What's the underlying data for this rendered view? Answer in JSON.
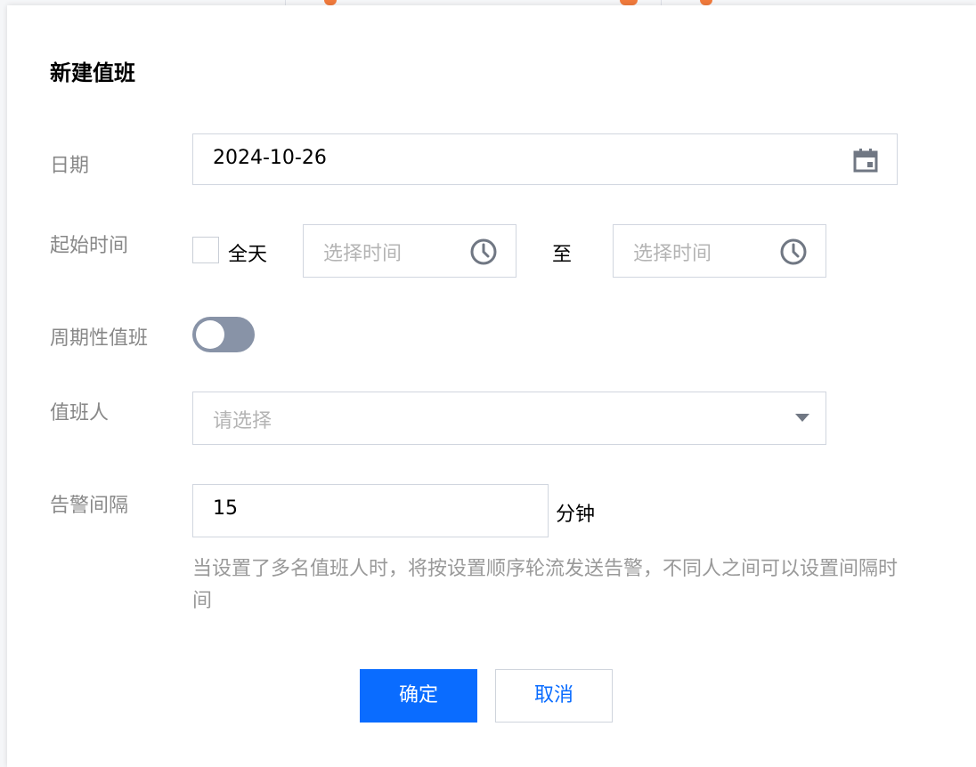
{
  "dialog": {
    "title": "新建值班"
  },
  "form": {
    "date": {
      "label": "日期",
      "value": "2024-10-26",
      "icon": "calendar-icon"
    },
    "start_time": {
      "label": "起始时间",
      "all_day_label": "全天",
      "all_day_checked": false,
      "start_placeholder": "选择时间",
      "separator": "至",
      "end_placeholder": "选择时间",
      "icon": "clock-icon"
    },
    "recurring": {
      "label": "周期性值班",
      "enabled": false
    },
    "on_duty_person": {
      "label": "值班人",
      "placeholder": "请选择",
      "icon": "caret-down-icon"
    },
    "alert_interval": {
      "label": "告警间隔",
      "value": "15",
      "unit": "分钟",
      "helper": "当设置了多名值班人时，将按设置顺序轮流发送告警，不同人之间可以设置间隔时间"
    }
  },
  "actions": {
    "confirm": "确定",
    "cancel": "取消"
  },
  "colors": {
    "primary": "#0a6cff",
    "label": "#888888",
    "border": "#d1d6df",
    "toggle_off": "#8893a7",
    "background_accent": "#f07a3c"
  }
}
